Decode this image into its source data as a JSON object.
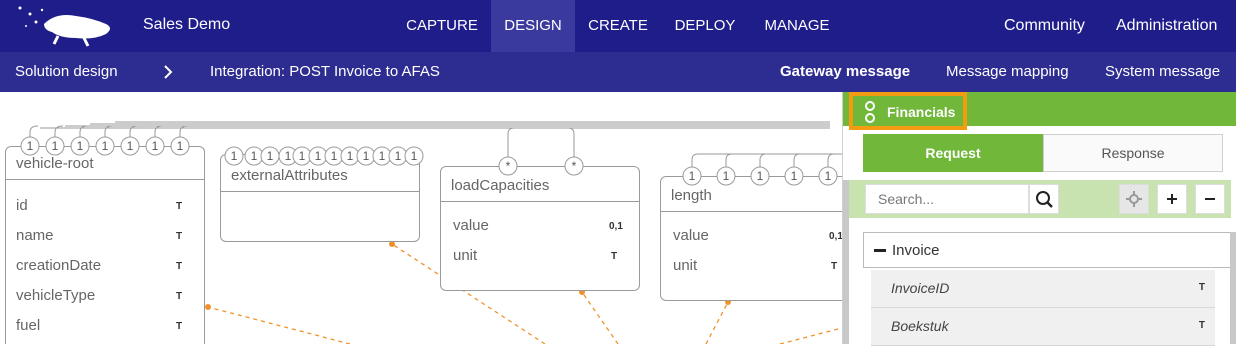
{
  "app": {
    "name": "Sales Demo"
  },
  "nav": {
    "items": [
      {
        "label": "CAPTURE"
      },
      {
        "label": "DESIGN"
      },
      {
        "label": "CREATE"
      },
      {
        "label": "DEPLOY"
      },
      {
        "label": "MANAGE"
      }
    ],
    "community": "Community",
    "administration": "Administration"
  },
  "subnav": {
    "breadcrumb_root": "Solution design",
    "breadcrumb_current": "Integration: POST Invoice to AFAS",
    "tabs": [
      "Gateway message",
      "Message mapping",
      "System message"
    ]
  },
  "canvas": {
    "connector_one": "1",
    "connector_star": "*",
    "entities": [
      {
        "title": "vehicle-root",
        "fields": [
          {
            "name": "id",
            "type": "T"
          },
          {
            "name": "name",
            "type": "T"
          },
          {
            "name": "creationDate",
            "type": "T"
          },
          {
            "name": "vehicleType",
            "type": "T"
          },
          {
            "name": "fuel",
            "type": "T"
          }
        ]
      },
      {
        "title": "externalAttributes",
        "fields": []
      },
      {
        "title": "loadCapacities",
        "fields": [
          {
            "name": "value",
            "type": "0,1"
          },
          {
            "name": "unit",
            "type": "T"
          }
        ]
      },
      {
        "title": "length",
        "fields": [
          {
            "name": "value",
            "type": "0,1"
          },
          {
            "name": "unit",
            "type": "T"
          }
        ]
      }
    ]
  },
  "panel": {
    "section_title": "Financials",
    "tabs": {
      "request": "Request",
      "response": "Response"
    },
    "search_placeholder": "Search...",
    "tree": {
      "root": "Invoice",
      "rows": [
        {
          "name": "InvoiceID",
          "type": "T"
        },
        {
          "name": "Boekstuk",
          "type": "T"
        }
      ]
    }
  },
  "colors": {
    "topbar": "#1e1d8a",
    "subbar": "#2d2c91",
    "green": "#70b73a",
    "highlight": "#f39c12",
    "dashed_link": "#f0922b"
  }
}
